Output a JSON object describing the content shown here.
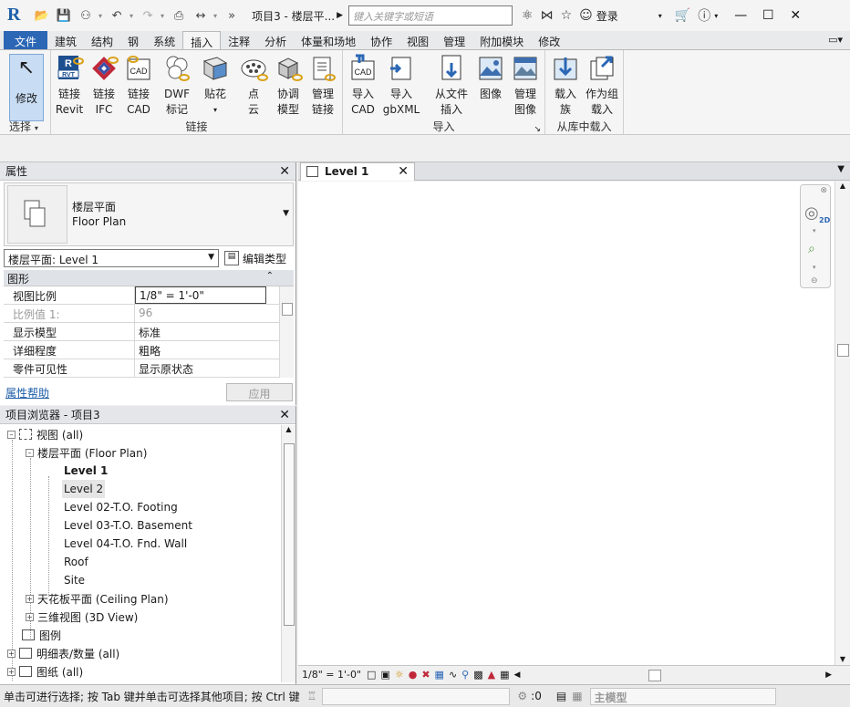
{
  "title": {
    "logo": "R",
    "document": "项目3 - 楼层平...",
    "search_placeholder": "键入关键字或短语",
    "login": "登录"
  },
  "tabs": [
    "文件",
    "建筑",
    "结构",
    "钢",
    "系统",
    "插入",
    "注释",
    "分析",
    "体量和场地",
    "协作",
    "视图",
    "管理",
    "附加模块",
    "修改"
  ],
  "active_tab": "插入",
  "ribbon": {
    "select_group": {
      "modify": "修改",
      "label": "选择"
    },
    "link_group": {
      "label": "链接",
      "tools": [
        {
          "l1": "链接",
          "l2": "Revit",
          "icon": "link-revit-icon"
        },
        {
          "l1": "链接",
          "l2": "IFC",
          "icon": "link-ifc-icon"
        },
        {
          "l1": "链接",
          "l2": "CAD",
          "icon": "link-cad-icon"
        },
        {
          "l1": "DWF",
          "l2": "标记",
          "icon": "dwf-markup-icon"
        },
        {
          "l1": "贴花",
          "l2": "",
          "icon": "decal-icon"
        },
        {
          "l1": "点",
          "l2": "云",
          "icon": "point-cloud-icon"
        },
        {
          "l1": "协调",
          "l2": "模型",
          "icon": "coordination-model-icon"
        },
        {
          "l1": "管理",
          "l2": "链接",
          "icon": "manage-links-icon"
        }
      ]
    },
    "import_group": {
      "label": "导入",
      "tools": [
        {
          "l1": "导入",
          "l2": "CAD",
          "icon": "import-cad-icon"
        },
        {
          "l1": "导入",
          "l2": "gbXML",
          "icon": "import-gbxml-icon"
        },
        {
          "l1": "从文件",
          "l2": "插入",
          "icon": "insert-from-file-icon"
        },
        {
          "l1": "图像",
          "l2": "",
          "icon": "image-icon"
        },
        {
          "l1": "管理",
          "l2": "图像",
          "icon": "manage-images-icon"
        }
      ]
    },
    "library_group": {
      "label": "从库中载入",
      "tools": [
        {
          "l1": "载入",
          "l2": "族",
          "icon": "load-family-icon"
        },
        {
          "l1": "作为组",
          "l2": "载入",
          "icon": "load-as-group-icon"
        }
      ]
    }
  },
  "properties": {
    "title": "属性",
    "type_cn": "楼层平面",
    "type_en": "Floor Plan",
    "instance": "楼层平面: Level 1",
    "edit_type": "编辑类型",
    "group": "图形",
    "rows": [
      {
        "k": "视图比例",
        "v": "1/8\" = 1'-0\""
      },
      {
        "k": "比例值 1:",
        "v": "96"
      },
      {
        "k": "显示模型",
        "v": "标准"
      },
      {
        "k": "详细程度",
        "v": "粗略"
      },
      {
        "k": "零件可见性",
        "v": "显示原状态"
      }
    ],
    "help": "属性帮助",
    "apply": "应用"
  },
  "browser": {
    "title": "项目浏览器 - 项目3",
    "views": "视图 (all)",
    "floor_plan": "楼层平面 (Floor Plan)",
    "levels": [
      "Level 1",
      "Level 2",
      "Level 02-T.O. Footing",
      "Level 03-T.O. Basement",
      "Level 04-T.O. Fnd. Wall",
      "Roof",
      "Site"
    ],
    "ceiling": "天花板平面 (Ceiling Plan)",
    "view3d": "三维视图 (3D View)",
    "legends": "图例",
    "schedules": "明细表/数量 (all)",
    "sheets": "图纸 (all)"
  },
  "view": {
    "tab": "Level 1",
    "scale": "1/8\" = 1'-0\""
  },
  "status": {
    "hint": "单击可进行选择; 按 Tab 键并单击可选择其他项目; 按 Ctrl 键",
    "count": ":0",
    "model": "主模型"
  }
}
